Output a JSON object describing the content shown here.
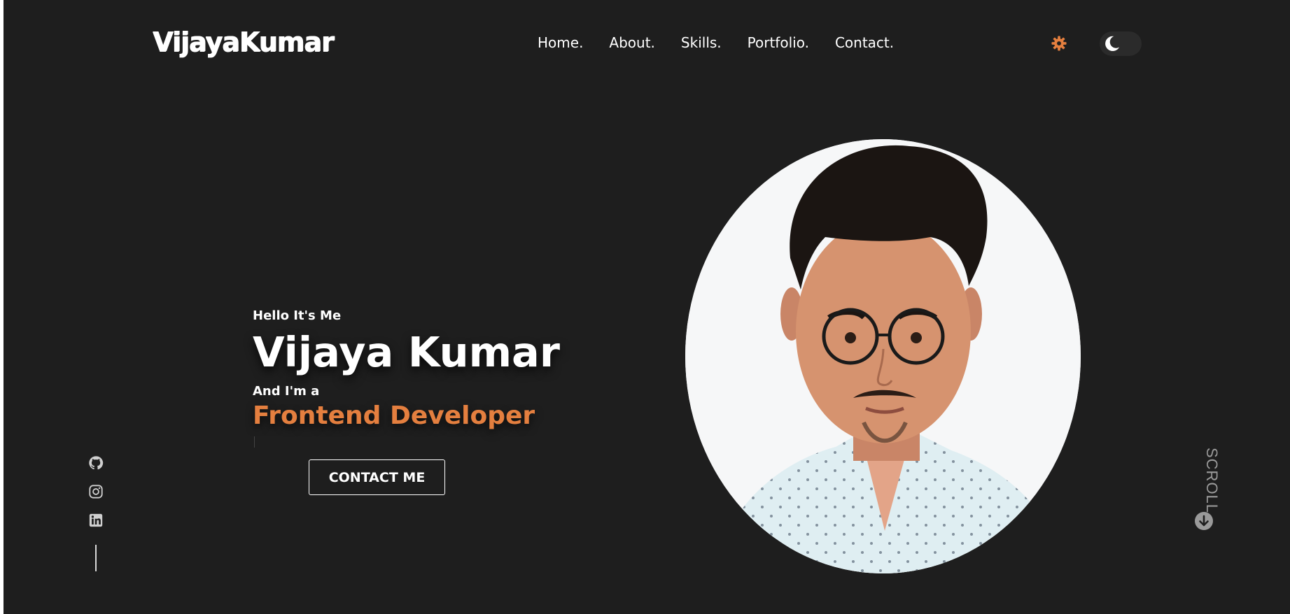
{
  "header": {
    "logo": "VijayaKumar",
    "nav": [
      "Home.",
      "About.",
      "Skills.",
      "Portfolio.",
      "Contact."
    ],
    "settings_icon": "gear-icon",
    "theme_toggle_icon": "moon-icon"
  },
  "hero": {
    "greeting": "Hello It's Me",
    "name": "Vijaya Kumar",
    "intro": "And I'm a",
    "role": "Frontend Developer",
    "cta_label": "CONTACT ME",
    "profile_photo_icon": "profile-photo"
  },
  "social": {
    "icons": [
      "github-icon",
      "instagram-icon",
      "linkedin-icon"
    ]
  },
  "scroll": {
    "label": "SCROLL",
    "icon": "arrow-down-circle-icon"
  },
  "colors": {
    "background": "#1e1e1e",
    "accent": "#e47f3f",
    "text": "#ffffff",
    "muted": "#9a9a9a"
  }
}
